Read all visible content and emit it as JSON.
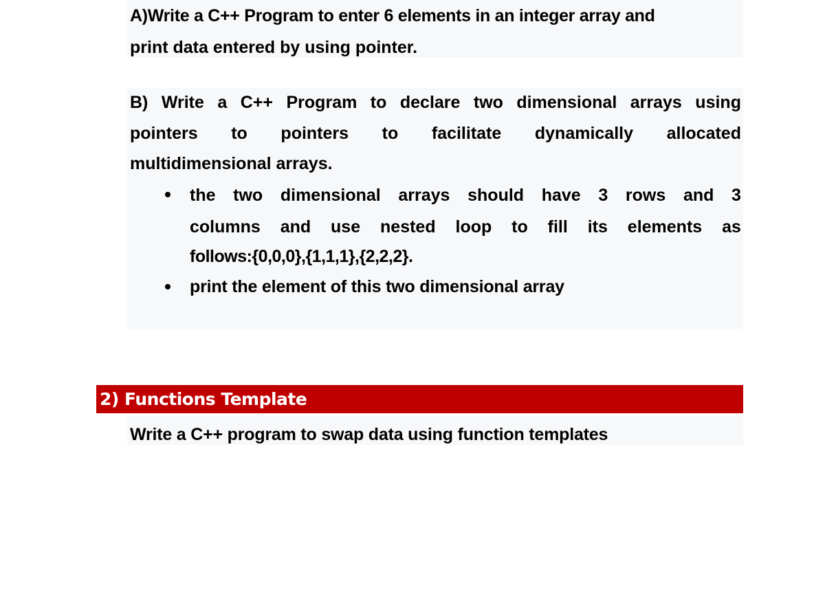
{
  "section_1": {
    "part_a": {
      "line1": "A)Write a C++ Program to enter 6 elements in  an integer array and",
      "line2": "print data entered by using pointer."
    },
    "part_b": {
      "line1_words": [
        "B)",
        "Write",
        "a",
        "C++",
        "Program",
        "to",
        "declare",
        "two",
        "dimensional",
        "arrays",
        "using"
      ],
      "line2_words": [
        "pointers",
        "to",
        "pointers",
        "to",
        "facilitate",
        "dynamically",
        "allocated"
      ],
      "line3": "multidimensional arrays.",
      "bullets": [
        {
          "line1_words": [
            "the",
            "two",
            "dimensional",
            "arrays",
            "should",
            "have",
            "3",
            "rows",
            "and",
            "3"
          ],
          "line2_words": [
            "columns",
            "and",
            "use",
            "nested",
            "loop",
            "to",
            "fill",
            "its",
            "elements",
            "as"
          ],
          "line3": "follows:{0,0,0},{1,1,1},{2,2,2}."
        },
        {
          "line1": "print the element of this two dimensional array"
        }
      ]
    }
  },
  "section_2": {
    "heading": "2) Functions Template",
    "heading_color": "#c00000",
    "body": "Write a C++ program to swap data using function templates"
  }
}
